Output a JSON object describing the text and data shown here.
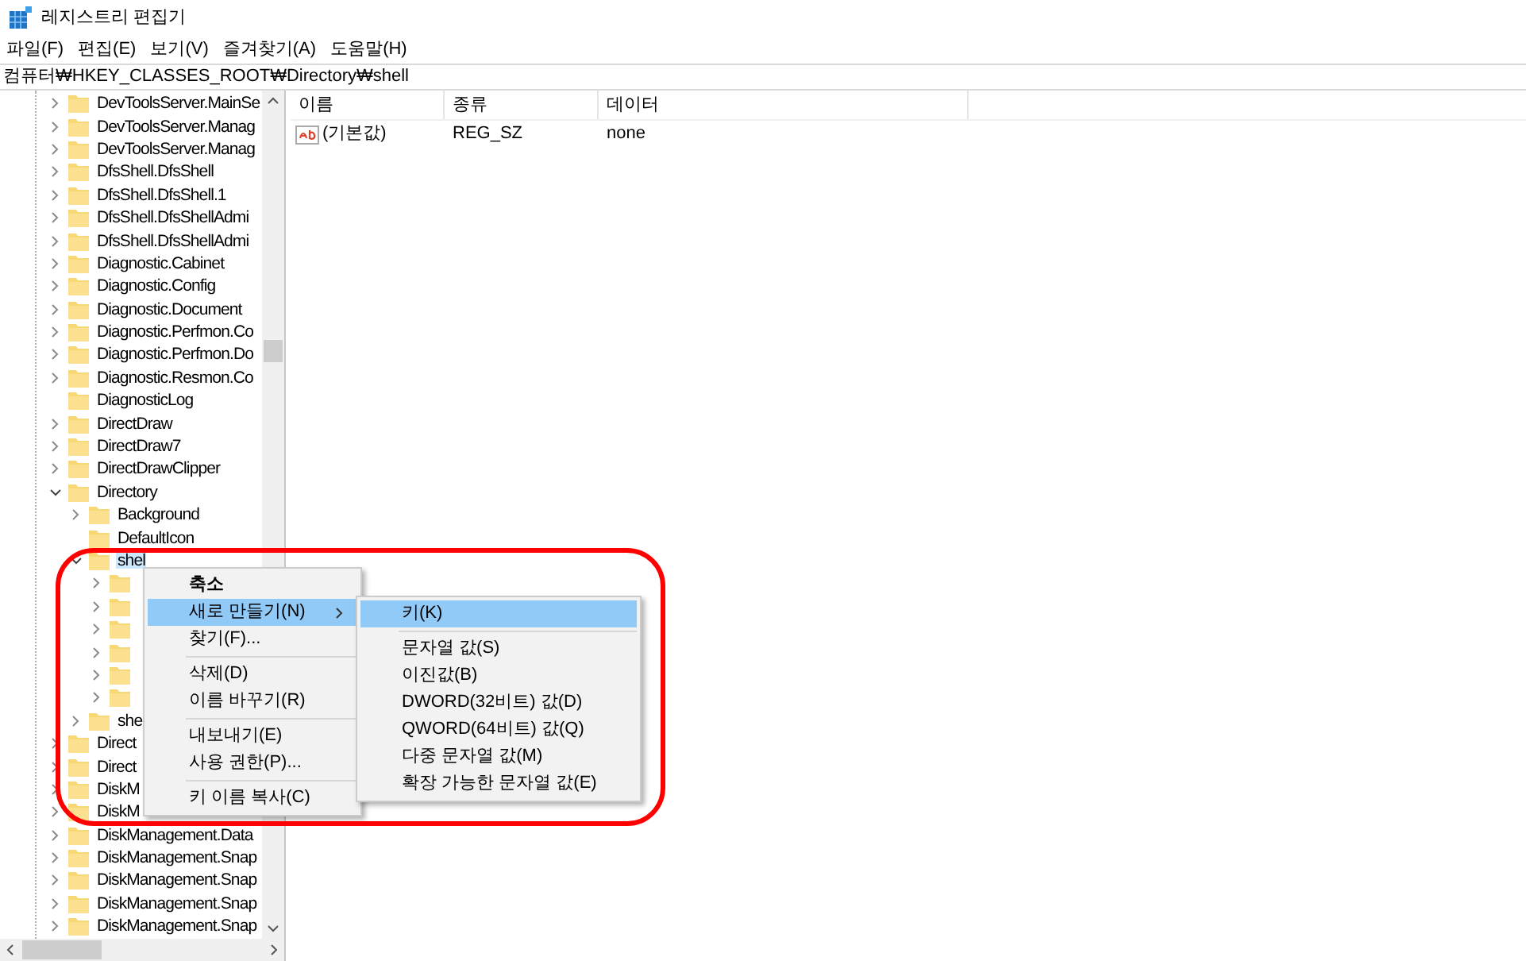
{
  "window": {
    "title": "레지스트리 편집기"
  },
  "menu_bar": [
    "파일(F)",
    "편집(E)",
    "보기(V)",
    "즐겨찾기(A)",
    "도움말(H)"
  ],
  "address": "컴퓨터₩HKEY_CLASSES_ROOT₩Directory₩shell",
  "tree": [
    {
      "label": "DevToolsServer.MainSe",
      "kind": "branch",
      "expanded": false,
      "selected": false
    },
    {
      "label": "DevToolsServer.Manag",
      "kind": "branch",
      "expanded": false,
      "selected": false
    },
    {
      "label": "DevToolsServer.Manag",
      "kind": "branch",
      "expanded": false,
      "selected": false
    },
    {
      "label": "DfsShell.DfsShell",
      "kind": "branch",
      "expanded": false,
      "selected": false
    },
    {
      "label": "DfsShell.DfsShell.1",
      "kind": "branch",
      "expanded": false,
      "selected": false
    },
    {
      "label": "DfsShell.DfsShellAdmi",
      "kind": "branch",
      "expanded": false,
      "selected": false
    },
    {
      "label": "DfsShell.DfsShellAdmi",
      "kind": "branch",
      "expanded": false,
      "selected": false
    },
    {
      "label": "Diagnostic.Cabinet",
      "kind": "branch",
      "expanded": false,
      "selected": false
    },
    {
      "label": "Diagnostic.Config",
      "kind": "branch",
      "expanded": false,
      "selected": false
    },
    {
      "label": "Diagnostic.Document",
      "kind": "branch",
      "expanded": false,
      "selected": false
    },
    {
      "label": "Diagnostic.Perfmon.Co",
      "kind": "branch",
      "expanded": false,
      "selected": false
    },
    {
      "label": "Diagnostic.Perfmon.Do",
      "kind": "branch",
      "expanded": false,
      "selected": false
    },
    {
      "label": "Diagnostic.Resmon.Co",
      "kind": "branch",
      "expanded": false,
      "selected": false
    },
    {
      "label": "DiagnosticLog",
      "kind": "leaf",
      "selected": false
    },
    {
      "label": "DirectDraw",
      "kind": "branch",
      "expanded": false,
      "selected": false
    },
    {
      "label": "DirectDraw7",
      "kind": "branch",
      "expanded": false,
      "selected": false
    },
    {
      "label": "DirectDrawClipper",
      "kind": "branch",
      "expanded": false,
      "selected": false
    },
    {
      "label": "Directory",
      "kind": "branch",
      "expanded": true,
      "selected": false,
      "children": [
        {
          "label": "Background",
          "kind": "branch",
          "expanded": false,
          "selected": false
        },
        {
          "label": "DefaultIcon",
          "kind": "leaf",
          "selected": false
        },
        {
          "label": "shel",
          "kind": "branch",
          "expanded": true,
          "selected": true,
          "children": [
            {
              "kind": "branch",
              "expanded": false,
              "selected": false
            },
            {
              "kind": "branch",
              "expanded": false,
              "selected": false
            },
            {
              "kind": "branch",
              "expanded": false,
              "selected": false
            },
            {
              "kind": "branch",
              "expanded": false,
              "selected": false
            },
            {
              "kind": "branch",
              "expanded": false,
              "selected": false
            },
            {
              "kind": "branch",
              "expanded": false,
              "selected": false
            }
          ]
        },
        {
          "label": "she",
          "kind": "branch",
          "expanded": false,
          "selected": false
        }
      ]
    },
    {
      "label": "Direct",
      "kind": "branch",
      "expanded": false,
      "selected": false
    },
    {
      "label": "Direct",
      "kind": "branch",
      "expanded": false,
      "selected": false
    },
    {
      "label": "DiskM",
      "kind": "branch",
      "expanded": false,
      "selected": false
    },
    {
      "label": "DiskM",
      "kind": "branch",
      "expanded": false,
      "selected": false
    },
    {
      "label": "DiskManagement.Data",
      "kind": "branch",
      "expanded": false,
      "selected": false
    },
    {
      "label": "DiskManagement.Snap",
      "kind": "branch",
      "expanded": false,
      "selected": false
    },
    {
      "label": "DiskManagement.Snap",
      "kind": "branch",
      "expanded": false,
      "selected": false
    },
    {
      "label": "DiskManagement.Snap",
      "kind": "branch",
      "expanded": false,
      "selected": false
    },
    {
      "label": "DiskManagement.Snap",
      "kind": "branch",
      "expanded": false,
      "selected": false
    }
  ],
  "values_table": {
    "columns": [
      "이름",
      "종류",
      "데이터"
    ],
    "rows": [
      {
        "name": "(기본값)",
        "type": "REG_SZ",
        "data": "none"
      }
    ]
  },
  "context_menu": [
    {
      "kind": "default",
      "label": "축소",
      "selected": false
    },
    {
      "kind": "submenu",
      "label": "새로 만들기(N)",
      "selected": true
    },
    {
      "kind": "item",
      "label": "찾기(F)...",
      "selected": false
    },
    {
      "kind": "separator"
    },
    {
      "kind": "item",
      "label": "삭제(D)",
      "selected": false
    },
    {
      "kind": "item",
      "label": "이름 바꾸기(R)",
      "selected": false
    },
    {
      "kind": "separator"
    },
    {
      "kind": "item",
      "label": "내보내기(E)",
      "selected": false
    },
    {
      "kind": "item",
      "label": "사용 권한(P)...",
      "selected": false
    },
    {
      "kind": "separator"
    },
    {
      "kind": "item",
      "label": "키 이름 복사(C)",
      "selected": false
    }
  ],
  "submenu": [
    {
      "kind": "item",
      "label": "키(K)",
      "selected": true
    },
    {
      "kind": "separator"
    },
    {
      "kind": "item",
      "label": "문자열 값(S)",
      "selected": false
    },
    {
      "kind": "item",
      "label": "이진값(B)",
      "selected": false
    },
    {
      "kind": "item",
      "label": "DWORD(32비트) 값(D)",
      "selected": false
    },
    {
      "kind": "item",
      "label": "QWORD(64비트) 값(Q)",
      "selected": false
    },
    {
      "kind": "item",
      "label": "다중 문자열 값(M)",
      "selected": false
    },
    {
      "kind": "item",
      "label": "확장 가능한 문자열 값(E)",
      "selected": false
    }
  ]
}
